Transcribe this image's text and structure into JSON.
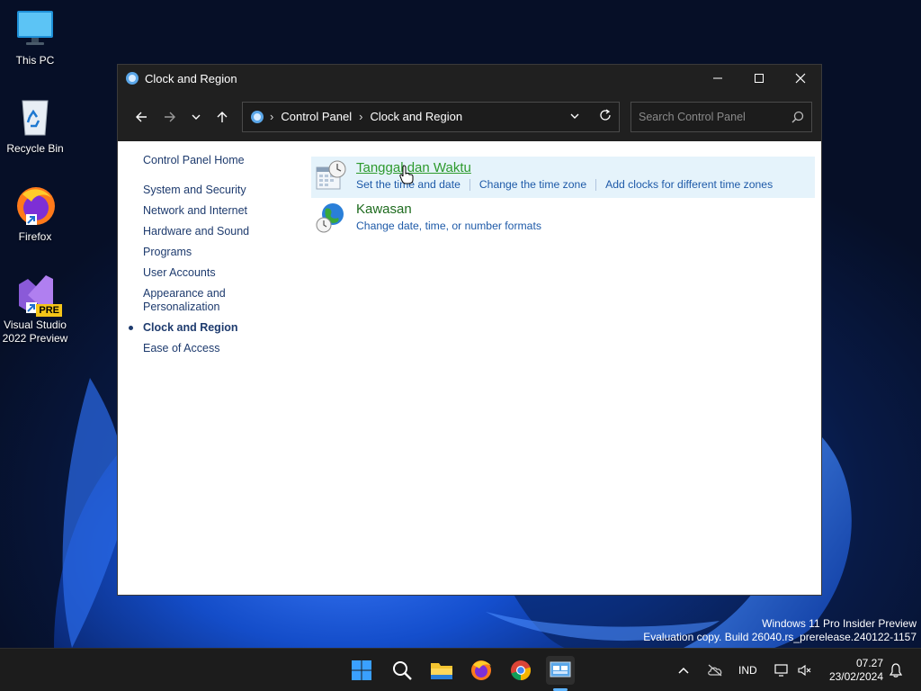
{
  "desktop": {
    "icons": [
      {
        "label": "This PC",
        "icon": "monitor-icon"
      },
      {
        "label": "Recycle Bin",
        "icon": "recycle-bin-icon"
      },
      {
        "label": "Firefox",
        "icon": "firefox-icon"
      },
      {
        "label": "Visual Studio 2022 Preview",
        "icon": "visual-studio-icon",
        "badge": "PRE"
      }
    ]
  },
  "window": {
    "title": "Clock and Region",
    "breadcrumb": [
      "Control Panel",
      "Clock and Region"
    ],
    "search_placeholder": "Search Control Panel"
  },
  "sidebar": {
    "home": "Control Panel Home",
    "items": [
      {
        "label": "System and Security"
      },
      {
        "label": "Network and Internet"
      },
      {
        "label": "Hardware and Sound"
      },
      {
        "label": "Programs"
      },
      {
        "label": "User Accounts"
      },
      {
        "label": "Appearance and Personalization"
      },
      {
        "label": "Clock and Region",
        "active": true
      },
      {
        "label": "Ease of Access"
      }
    ]
  },
  "categories": [
    {
      "title": "Tanggal dan Waktu",
      "icon": "calendar-clock-icon",
      "links": [
        "Set the time and date",
        "Change the time zone",
        "Add clocks for different time zones"
      ]
    },
    {
      "title": "Kawasan",
      "icon": "globe-clock-icon",
      "links": [
        "Change date, time, or number formats"
      ]
    }
  ],
  "watermark": {
    "line1": "Windows 11 Pro Insider Preview",
    "line2": "Evaluation copy. Build 26040.rs_prerelease.240122-1157"
  },
  "taskbar": {
    "apps": [
      "start-icon",
      "search-icon",
      "file-explorer-icon",
      "firefox-icon",
      "chrome-icon",
      "control-panel-icon"
    ],
    "language": "IND",
    "time": "07.27",
    "date": "23/02/2024"
  }
}
